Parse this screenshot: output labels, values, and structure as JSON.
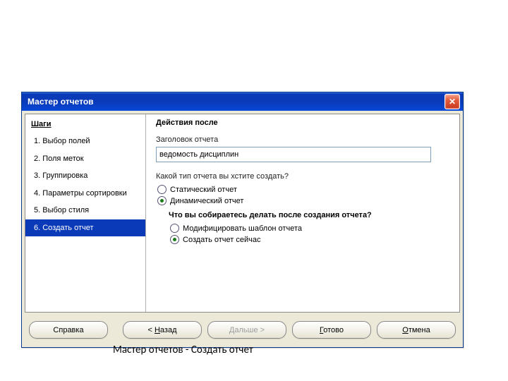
{
  "dialog": {
    "title": "Мастер отчетов"
  },
  "sidebar": {
    "header": "Шаги",
    "items": [
      {
        "label": "1. Выбор полей"
      },
      {
        "label": "2. Поля меток"
      },
      {
        "label": "3. Группировка"
      },
      {
        "label": "4. Параметры сортировки"
      },
      {
        "label": "5. Выбор стиля"
      },
      {
        "label": "6. Создать отчет"
      }
    ]
  },
  "main": {
    "header": "Действия после",
    "title_label": "Заголовок отчета",
    "title_value": "ведомость дисциплин",
    "q1": "Какой тип отчета вы хстите создать?",
    "r_static": "Статический отчет",
    "r_dynamic": "Динамический отчет",
    "q2": "Что вы собираетесь делать после создания отчета?",
    "r_modify": "Модифицировать шаблон отчета",
    "r_createnow": "Создать отчет сейчас"
  },
  "buttons": {
    "help": "Справка",
    "back_pre": "< ",
    "back_u": "Н",
    "back_post": "азад",
    "next_pre": "",
    "next_u": "Д",
    "next_post": "альше >",
    "done_pre": "",
    "done_u": "Г",
    "done_post": "отово",
    "cancel_pre": "",
    "cancel_u": "О",
    "cancel_post": "тмена"
  },
  "caption": "Мастер отчетов - Создать отчет"
}
